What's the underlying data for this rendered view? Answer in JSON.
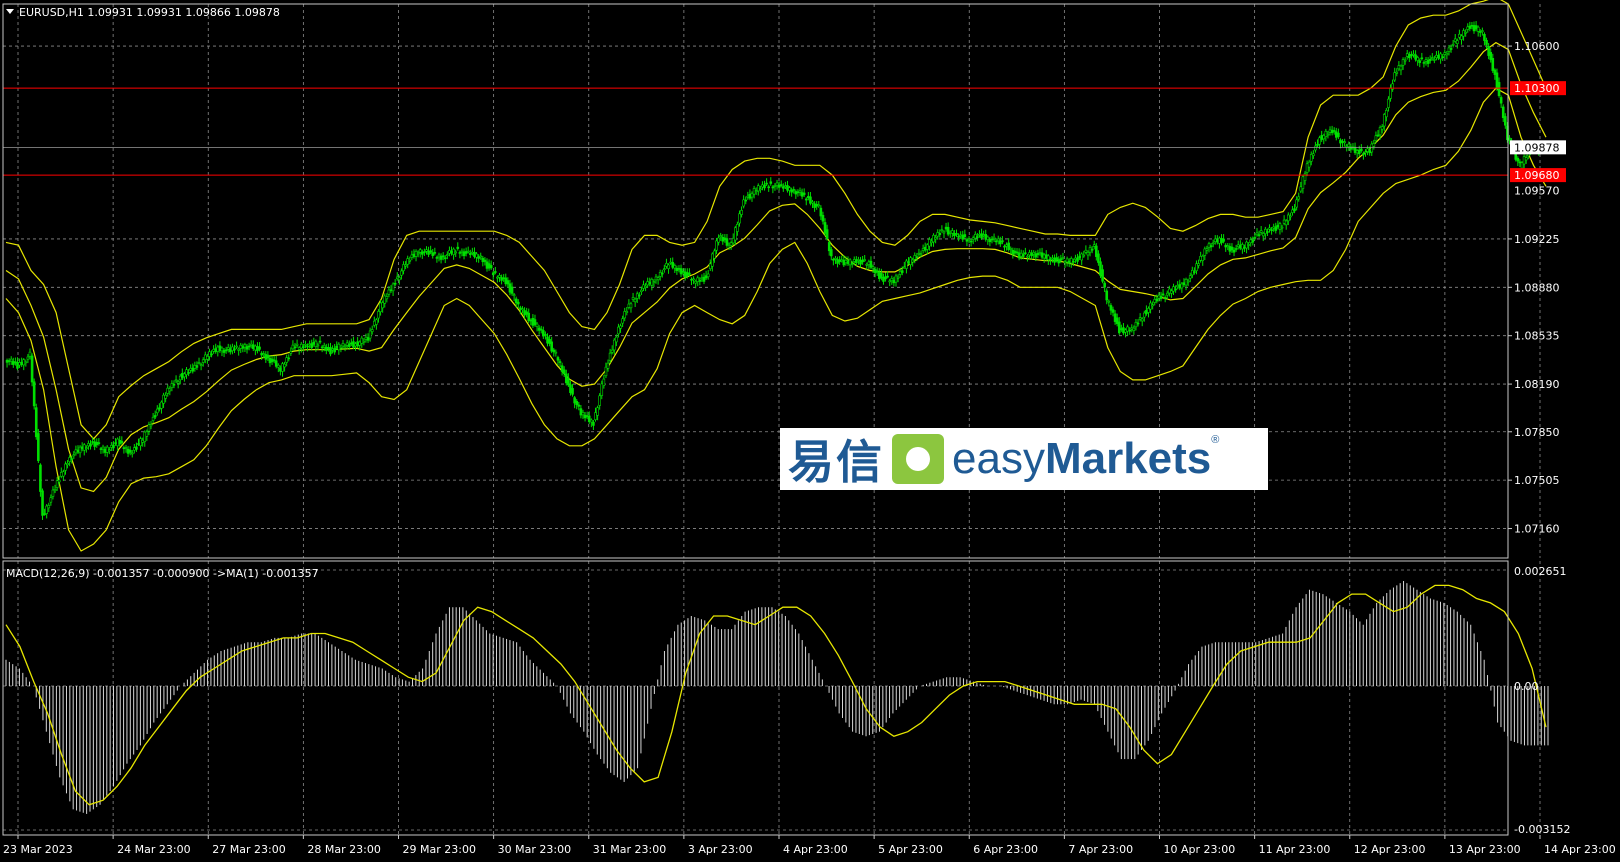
{
  "symbol_header": "EURUSD,H1  1.09931 1.09931 1.09866 1.09878",
  "macd_header": "MACD(12,26,9) -0.001357 -0.000900  ->MA(1) -0.001357",
  "watermark": {
    "cn": "易信",
    "en_light": "easy",
    "en_bold": "Markets",
    "reg": "®"
  },
  "colors": {
    "background": "#000000",
    "grid": "#8c8c8c",
    "candle": "#00e000",
    "bands": "#e6e600",
    "hline": "#ff0000",
    "histogram": "#d8d8d8",
    "signal": "#e6e600"
  },
  "chart_data": [
    {
      "type": "line",
      "title": "EURUSD,H1",
      "ohlc_last": {
        "open": 1.09931,
        "high": 1.09931,
        "low": 1.09866,
        "close": 1.09878
      },
      "ylim": [
        1.0695,
        1.109
      ],
      "y_ticks": [
        "1.10600",
        "1.09225",
        "1.08880",
        "1.08535",
        "1.08190",
        "1.07850",
        "1.07505",
        "1.07160"
      ],
      "x_ticks": [
        "23 Mar 2023",
        "24 Mar 23:00",
        "27 Mar 23:00",
        "28 Mar 23:00",
        "29 Mar 23:00",
        "30 Mar 23:00",
        "31 Mar 23:00",
        "3 Apr 23:00",
        "4 Apr 23:00",
        "5 Apr 23:00",
        "6 Apr 23:00",
        "7 Apr 23:00",
        "10 Apr 23:00",
        "11 Apr 23:00",
        "12 Apr 23:00",
        "13 Apr 23:00",
        "14 Apr 23:00"
      ],
      "price_labels": [
        {
          "text": "1.10300",
          "value": 1.103,
          "style": "red"
        },
        {
          "text": "1.09878",
          "value": 1.09878,
          "style": "white"
        },
        {
          "text": "1.09680",
          "value": 1.0968,
          "style": "red"
        },
        {
          "text": "1.09570",
          "value": 1.0957,
          "style": "plain"
        }
      ],
      "hlines": [
        1.103,
        1.0968
      ],
      "series": [
        {
          "name": "EURUSD close",
          "values": [
            1.0838,
            1.0832,
            1.084,
            1.0725,
            1.0745,
            1.0765,
            1.0773,
            1.0778,
            1.0772,
            1.0778,
            1.077,
            1.078,
            1.0798,
            1.0815,
            1.0825,
            1.083,
            1.0838,
            1.0845,
            1.0843,
            1.0847,
            1.0845,
            1.0838,
            1.083,
            1.0845,
            1.0847,
            1.0848,
            1.0843,
            1.0847,
            1.0848,
            1.0852,
            1.0875,
            1.089,
            1.0905,
            1.0915,
            1.0912,
            1.091,
            1.0915,
            1.0912,
            1.091,
            1.0898,
            1.0893,
            1.0875,
            1.0865,
            1.0855,
            1.084,
            1.0818,
            1.0798,
            1.0792,
            1.083,
            1.086,
            1.0878,
            1.0888,
            1.0895,
            1.0905,
            1.09,
            1.0893,
            1.0895,
            1.0925,
            1.0918,
            1.095,
            1.0958,
            1.0962,
            1.096,
            1.0958,
            1.0952,
            1.0945,
            1.091,
            1.0905,
            1.0908,
            1.0905,
            1.0895,
            1.0893,
            1.0905,
            1.0912,
            1.0922,
            1.093,
            1.0925,
            1.0923,
            1.0925,
            1.0922,
            1.0918,
            1.091,
            1.0913,
            1.091,
            1.0908,
            1.0907,
            1.091,
            1.0918,
            1.088,
            1.0858,
            1.0858,
            1.087,
            1.088,
            1.0885,
            1.089,
            1.09,
            1.0918,
            1.0922,
            1.0915,
            1.0918,
            1.0925,
            1.093,
            1.0932,
            1.0945,
            1.0975,
            1.0995,
            1.1,
            1.099,
            1.0985,
            1.0985,
            1.1005,
            1.104,
            1.1055,
            1.105,
            1.105,
            1.1055,
            1.1065,
            1.1075,
            1.107,
            1.104,
            1.0995,
            1.0975,
            1.0988,
            1.0988
          ]
        },
        {
          "name": "Upper band",
          "values": [
            1.092,
            1.0918,
            1.09,
            1.089,
            1.087,
            1.083,
            1.079,
            1.078,
            1.079,
            1.081,
            1.0818,
            1.0825,
            1.083,
            1.0835,
            1.0842,
            1.0848,
            1.0852,
            1.0855,
            1.0858,
            1.0858,
            1.0858,
            1.0858,
            1.0858,
            1.086,
            1.0862,
            1.0862,
            1.0862,
            1.0862,
            1.0862,
            1.0865,
            1.088,
            1.0908,
            1.0925,
            1.0928,
            1.0928,
            1.0928,
            1.0928,
            1.0928,
            1.0928,
            1.0928,
            1.0925,
            1.092,
            1.091,
            1.09,
            1.0885,
            1.087,
            1.086,
            1.0858,
            1.087,
            1.089,
            1.0915,
            1.0925,
            1.0925,
            1.092,
            1.0918,
            1.092,
            1.0935,
            1.096,
            1.0972,
            1.0978,
            1.098,
            1.098,
            1.0978,
            1.0975,
            1.0975,
            1.0975,
            1.0968,
            1.0955,
            1.094,
            1.0928,
            1.092,
            1.0918,
            1.0925,
            1.0935,
            1.094,
            1.094,
            1.0938,
            1.0936,
            1.0935,
            1.0934,
            1.0932,
            1.093,
            1.0928,
            1.0926,
            1.0926,
            1.0925,
            1.0925,
            1.0925,
            1.094,
            1.0945,
            1.0948,
            1.0945,
            1.0938,
            1.093,
            1.0928,
            1.0932,
            1.0937,
            1.094,
            1.094,
            1.0938,
            1.0938,
            1.094,
            1.0942,
            1.0955,
            1.0995,
            1.1018,
            1.1025,
            1.1025,
            1.1025,
            1.103,
            1.1038,
            1.106,
            1.1075,
            1.108,
            1.1082,
            1.1082,
            1.1085,
            1.109,
            1.1092,
            1.1095,
            1.109,
            1.107,
            1.105,
            1.103
          ]
        },
        {
          "name": "Lower band",
          "values": [
            1.088,
            1.087,
            1.085,
            1.0815,
            1.076,
            1.0715,
            1.07,
            1.0705,
            1.0715,
            1.0735,
            1.0748,
            1.0752,
            1.0753,
            1.0755,
            1.076,
            1.0765,
            1.0775,
            1.0788,
            1.08,
            1.0808,
            1.0815,
            1.082,
            1.0822,
            1.0825,
            1.0825,
            1.0825,
            1.0825,
            1.0826,
            1.0827,
            1.082,
            1.081,
            1.0808,
            1.0815,
            1.0835,
            1.0855,
            1.0875,
            1.088,
            1.0875,
            1.0865,
            1.0855,
            1.084,
            1.0823,
            1.0805,
            1.079,
            1.078,
            1.0775,
            1.0775,
            1.078,
            1.079,
            1.08,
            1.081,
            1.0815,
            1.083,
            1.0855,
            1.087,
            1.0875,
            1.087,
            1.0865,
            1.0862,
            1.0868,
            1.0885,
            1.0905,
            1.0915,
            1.092,
            1.0905,
            1.0885,
            1.0868,
            1.0864,
            1.0866,
            1.0872,
            1.0878,
            1.088,
            1.0882,
            1.0884,
            1.0887,
            1.089,
            1.0893,
            1.0895,
            1.0896,
            1.0896,
            1.0893,
            1.0888,
            1.0888,
            1.0888,
            1.0888,
            1.0885,
            1.088,
            1.0875,
            1.0845,
            1.0828,
            1.0822,
            1.0822,
            1.0825,
            1.0828,
            1.0832,
            1.0845,
            1.0858,
            1.0868,
            1.0876,
            1.088,
            1.0885,
            1.0888,
            1.089,
            1.0892,
            1.0893,
            1.0893,
            1.09,
            1.0915,
            1.0935,
            1.0945,
            1.0955,
            1.0962,
            1.0965,
            1.0968,
            1.0972,
            1.0975,
            1.0985,
            1.1,
            1.102,
            1.103,
            1.1025,
            1.0995,
            1.0975,
            1.096
          ]
        }
      ]
    },
    {
      "type": "bar",
      "title": "MACD(12,26,9)",
      "ylim": [
        -0.003152,
        0.002651
      ],
      "y_ticks": [
        "0.002651",
        "0.00",
        "-0.003152"
      ],
      "values": {
        "macd": -0.001357,
        "signal": -0.0009,
        "ma1": -0.001357
      },
      "series": [
        {
          "name": "MACD",
          "values": [
            0.0006,
            0.0004,
            0.0,
            -0.001,
            -0.002,
            -0.0027,
            -0.0028,
            -0.0026,
            -0.0022,
            -0.0017,
            -0.0013,
            -0.0008,
            -0.0004,
            0.0,
            0.0003,
            0.0006,
            0.0008,
            0.0009,
            0.001,
            0.001,
            0.0011,
            0.0011,
            0.0012,
            0.0012,
            0.001,
            0.0008,
            0.0006,
            0.0005,
            0.0004,
            0.0002,
            0.0001,
            0.0004,
            0.0012,
            0.0018,
            0.0018,
            0.0015,
            0.0012,
            0.0011,
            0.001,
            0.0006,
            0.0003,
            0.0,
            -0.0006,
            -0.001,
            -0.0015,
            -0.0019,
            -0.0021,
            -0.0018,
            -0.0005,
            0.0008,
            0.0014,
            0.0016,
            0.0015,
            0.0013,
            0.0013,
            0.0017,
            0.0018,
            0.0018,
            0.0016,
            0.0012,
            0.0006,
            0.0,
            -0.0006,
            -0.001,
            -0.0011,
            -0.001,
            -0.0006,
            -0.0003,
            0.0,
            0.0001,
            0.0002,
            0.0002,
            0.0001,
            0.0,
            0.0,
            -0.0001,
            -0.0002,
            -0.0003,
            -0.0004,
            -0.0004,
            -0.0003,
            -0.0004,
            -0.001,
            -0.0016,
            -0.0016,
            -0.0012,
            -0.0006,
            -0.0001,
            0.0005,
            0.0009,
            0.001,
            0.001,
            0.001,
            0.001,
            0.0011,
            0.0012,
            0.0018,
            0.0022,
            0.0021,
            0.0019,
            0.0017,
            0.0014,
            0.0019,
            0.0022,
            0.0024,
            0.0022,
            0.002,
            0.0019,
            0.0017,
            0.0014,
            0.0006,
            -0.0008,
            -0.0012,
            -0.0013,
            -0.0013
          ]
        },
        {
          "name": "Signal",
          "values": [
            0.0014,
            0.0009,
            0.0001,
            -0.0006,
            -0.0015,
            -0.0023,
            -0.0026,
            -0.0025,
            -0.0022,
            -0.0018,
            -0.0013,
            -0.0009,
            -0.0005,
            -0.0001,
            0.0002,
            0.0004,
            0.0006,
            0.0008,
            0.0009,
            0.001,
            0.0011,
            0.0011,
            0.0012,
            0.0012,
            0.0011,
            0.001,
            0.0008,
            0.0006,
            0.0004,
            0.0002,
            0.0001,
            0.0003,
            0.0009,
            0.0015,
            0.0018,
            0.0017,
            0.0015,
            0.0013,
            0.0011,
            0.0008,
            0.0005,
            0.0001,
            -0.0004,
            -0.0009,
            -0.0014,
            -0.0018,
            -0.0021,
            -0.002,
            -0.001,
            0.0003,
            0.0012,
            0.0016,
            0.0016,
            0.0015,
            0.0014,
            0.0016,
            0.0018,
            0.0018,
            0.0016,
            0.0012,
            0.0007,
            0.0001,
            -0.0005,
            -0.0009,
            -0.0011,
            -0.001,
            -0.0008,
            -0.0005,
            -0.0002,
            0.0,
            0.0001,
            0.0001,
            0.0001,
            0.0,
            -0.0001,
            -0.0002,
            -0.0003,
            -0.0004,
            -0.0004,
            -0.0004,
            -0.0005,
            -0.0009,
            -0.0014,
            -0.0017,
            -0.0015,
            -0.001,
            -0.0005,
            0.0,
            0.0005,
            0.0008,
            0.0009,
            0.001,
            0.001,
            0.001,
            0.0011,
            0.0015,
            0.0019,
            0.0021,
            0.0021,
            0.0019,
            0.0017,
            0.0018,
            0.0021,
            0.0023,
            0.0023,
            0.0022,
            0.002,
            0.0019,
            0.0017,
            0.0012,
            0.0004,
            -0.0009
          ]
        }
      ]
    }
  ]
}
